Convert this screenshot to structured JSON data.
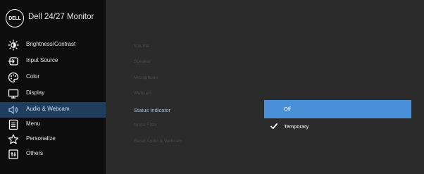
{
  "header": {
    "logo_text": "DELL",
    "title": "Dell 24/27 Monitor"
  },
  "nav": {
    "items": [
      {
        "label": "Brightness/Contrast",
        "icon": "brightness-icon"
      },
      {
        "label": "Input Source",
        "icon": "input-source-icon"
      },
      {
        "label": "Color",
        "icon": "color-palette-icon"
      },
      {
        "label": "Display",
        "icon": "display-icon"
      },
      {
        "label": "Audio & Webcam",
        "icon": "speaker-icon",
        "active": true
      },
      {
        "label": "Menu",
        "icon": "menu-icon"
      },
      {
        "label": "Personalize",
        "icon": "star-icon"
      },
      {
        "label": "Others",
        "icon": "others-icon"
      }
    ]
  },
  "submenu": {
    "items": [
      {
        "label": "Volume"
      },
      {
        "label": "Speaker"
      },
      {
        "label": "Microphone"
      },
      {
        "label": "Webcam"
      },
      {
        "label": "Status Indicator",
        "active": true
      },
      {
        "label": "Noise Filter"
      },
      {
        "label": "Reset Audio & Webcam"
      }
    ]
  },
  "options": {
    "items": [
      {
        "label": "Off",
        "selected": true,
        "checked": false
      },
      {
        "label": "Temporary",
        "selected": false,
        "checked": true
      }
    ]
  },
  "colors": {
    "sidebar_bg": "#0d0d0d",
    "panel_bg": "#2b2b2b",
    "active_nav_bg": "#1f3d5c",
    "highlight": "#4a90d9",
    "active_text": "#9dc4ea"
  }
}
